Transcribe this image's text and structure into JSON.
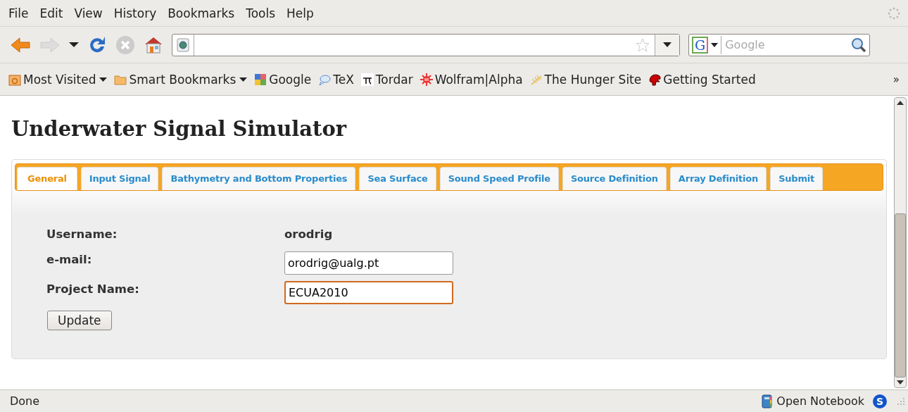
{
  "menu": [
    "File",
    "Edit",
    "View",
    "History",
    "Bookmarks",
    "Tools",
    "Help"
  ],
  "toolbar": {
    "search": {
      "engine": "G",
      "placeholder": "Google"
    }
  },
  "bookmarks": [
    {
      "label": "Most Visited",
      "kind": "menu"
    },
    {
      "label": "Smart Bookmarks",
      "kind": "menu"
    },
    {
      "label": "Google",
      "kind": "link"
    },
    {
      "label": "TeX",
      "kind": "link"
    },
    {
      "label": "Tordar",
      "kind": "link"
    },
    {
      "label": "Wolfram|Alpha",
      "kind": "link"
    },
    {
      "label": "The Hunger Site",
      "kind": "link"
    },
    {
      "label": "Getting Started",
      "kind": "link"
    }
  ],
  "bookmarks_more": "»",
  "page": {
    "title": "Underwater Signal Simulator",
    "tabs": [
      {
        "label": "General",
        "selected": true
      },
      {
        "label": "Input Signal",
        "selected": false
      },
      {
        "label": "Bathymetry and Bottom Properties",
        "selected": false
      },
      {
        "label": "Sea Surface",
        "selected": false
      },
      {
        "label": "Sound Speed Profile",
        "selected": false
      },
      {
        "label": "Source Definition",
        "selected": false
      },
      {
        "label": "Array Definition",
        "selected": false
      },
      {
        "label": "Submit",
        "selected": false
      }
    ],
    "form": [
      {
        "label": "Username:",
        "kind": "text",
        "value": "orodrig"
      },
      {
        "label": "e-mail:",
        "kind": "input",
        "value": "orodrig@ualg.pt",
        "focused": false
      },
      {
        "label": "Project Name:",
        "kind": "input",
        "value": "ECUA2010",
        "focused": true
      }
    ],
    "button": "Update"
  },
  "status_bar": {
    "text": "Done",
    "notebook": "Open Notebook",
    "badge": "S"
  }
}
